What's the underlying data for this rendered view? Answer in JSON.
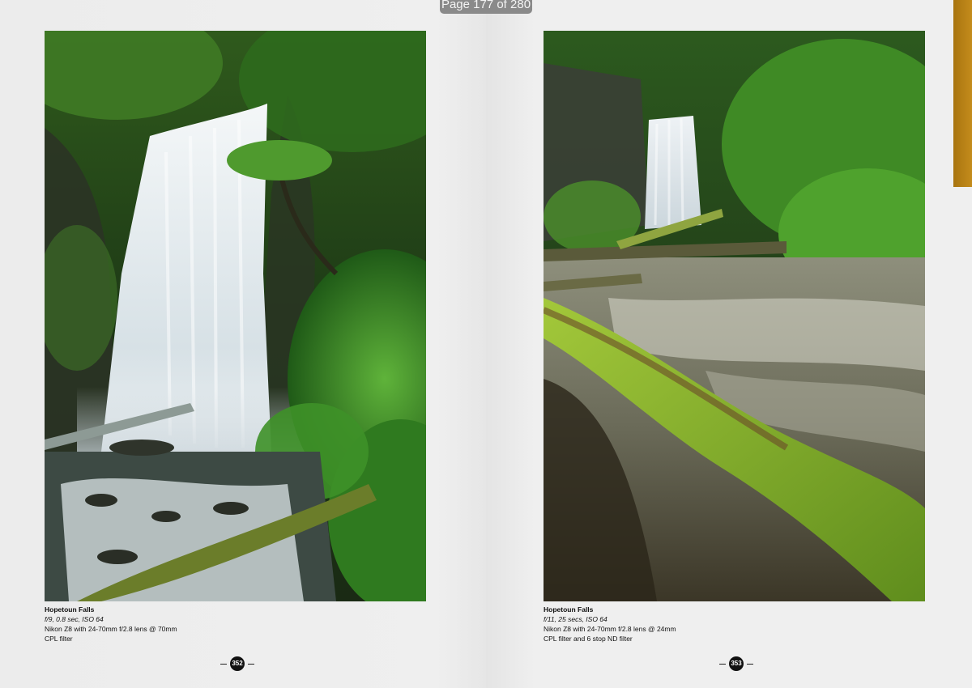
{
  "viewer": {
    "page_indicator": "Page 177 of 280",
    "accent_color": "#b8860b"
  },
  "left_page": {
    "photo_icon": "waterfall-photo",
    "caption": {
      "title": "Hopetoun Falls",
      "settings": "f/9, 0.8 sec, ISO 64",
      "gear": "Nikon Z8 with 24-70mm f/2.8 lens @ 70mm",
      "filter": "CPL filter"
    },
    "page_number": "352"
  },
  "right_page": {
    "photo_icon": "waterfall-river-photo",
    "caption": {
      "title": "Hopetoun Falls",
      "settings": "f/11, 25 secs, ISO 64",
      "gear": "Nikon Z8 with 24-70mm f/2.8 lens @ 24mm",
      "filter": "CPL filter and 6 stop ND filter"
    },
    "page_number": "353"
  }
}
